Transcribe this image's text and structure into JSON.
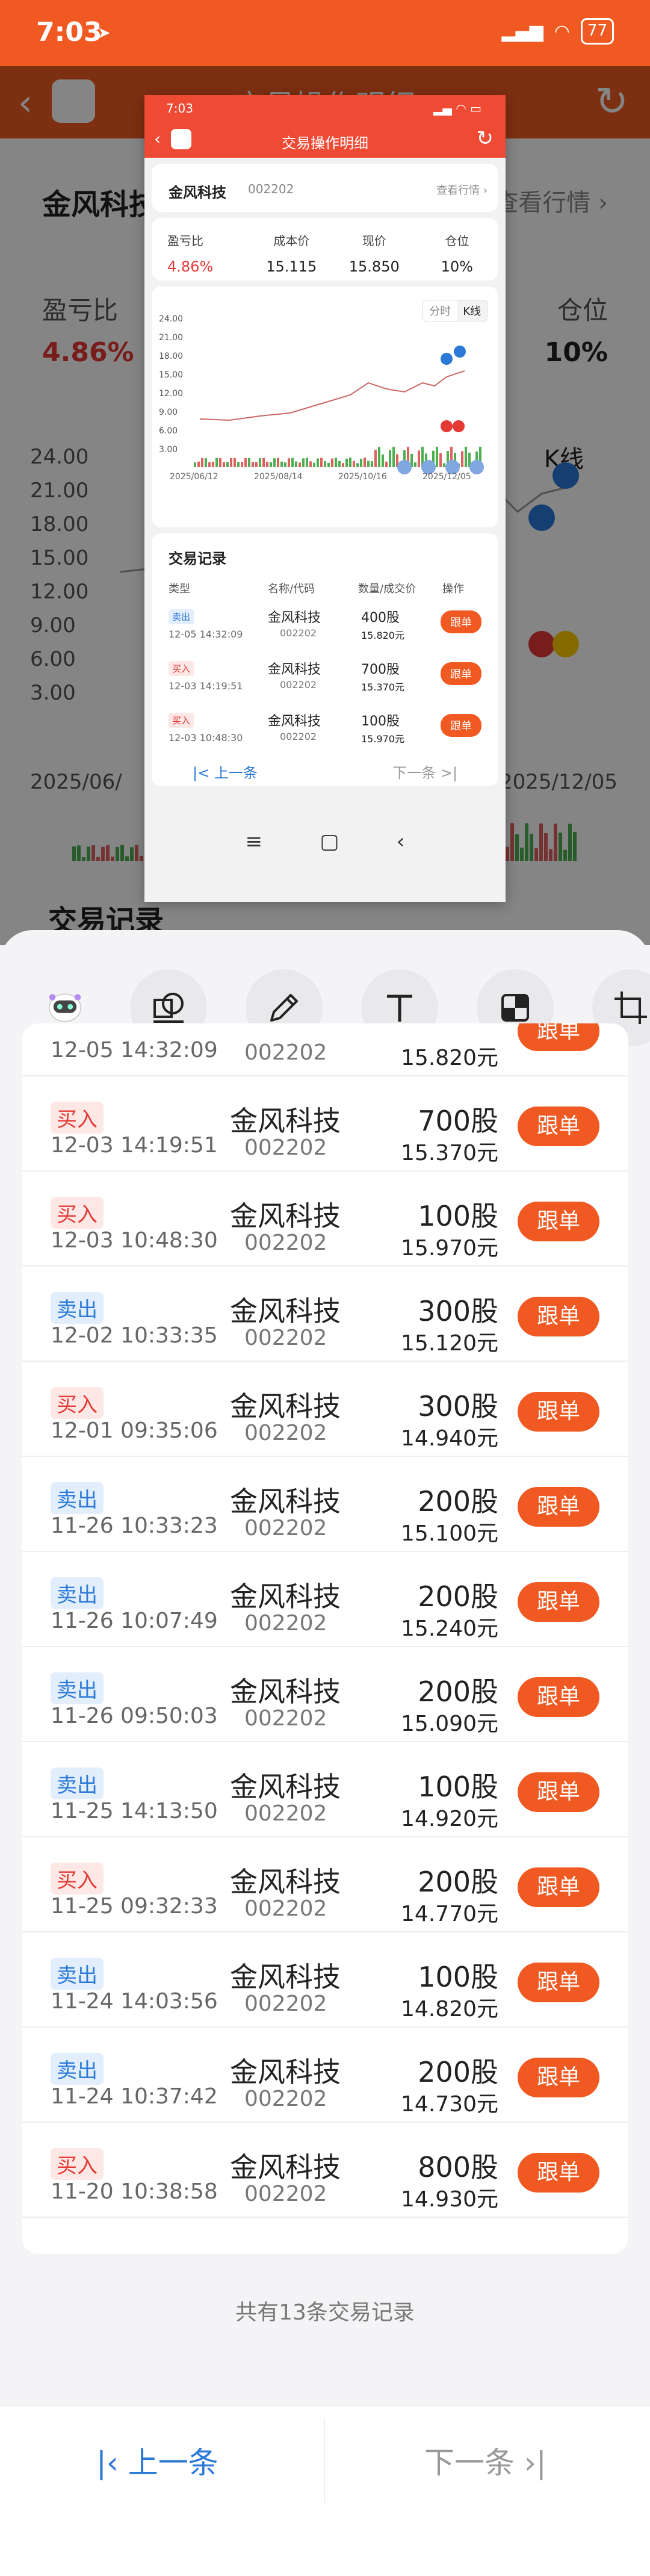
{
  "status_bar": {
    "time": "7:03",
    "battery": "77"
  },
  "background_app": {
    "title": "交易操作明细",
    "stock_name": "金风科技",
    "view_market": "查看行情 ›",
    "profit_label": "盈亏比",
    "profit_value": "4.86%",
    "position_label": "仓位",
    "position_value": "10%",
    "kline_label": "K线",
    "records_title": "交易记录",
    "y_ticks": [
      "24.00",
      "21.00",
      "18.00",
      "15.00",
      "12.00",
      "9.00",
      "6.00",
      "3.00"
    ],
    "x_tick_left": "2025/06/",
    "x_tick_right": "2025/12/05"
  },
  "preview": {
    "time": "7:03",
    "title": "交易操作明细",
    "stock_name": "金风科技",
    "stock_code": "002202",
    "view_market": "查看行情 ›",
    "stats": [
      {
        "label": "盈亏比",
        "value": "4.86%",
        "color": "#e53935"
      },
      {
        "label": "成本价",
        "value": "15.115"
      },
      {
        "label": "现价",
        "value": "15.850"
      },
      {
        "label": "仓位",
        "value": "10%"
      }
    ],
    "tabs": [
      "分时",
      "K线"
    ],
    "y_ticks": [
      "24.00",
      "21.00",
      "18.00",
      "15.00",
      "12.00",
      "9.00",
      "6.00",
      "3.00"
    ],
    "x_ticks": [
      "2025/06/12",
      "2025/08/14",
      "2025/10/16",
      "2025/12/05"
    ],
    "records_title": "交易记录",
    "columns": [
      "类型",
      "名称/代码",
      "数量/成交价",
      "操作"
    ],
    "rows": [
      {
        "type": "卖出",
        "kind": "sell",
        "time": "12-05 14:32:09",
        "name": "金风科技",
        "code": "002202",
        "qty": "400股",
        "price": "15.820元",
        "action": "跟单"
      },
      {
        "type": "买入",
        "kind": "buy",
        "time": "12-03 14:19:51",
        "name": "金风科技",
        "code": "002202",
        "qty": "700股",
        "price": "15.370元",
        "action": "跟单"
      },
      {
        "type": "买入",
        "kind": "buy",
        "time": "12-03 10:48:30",
        "name": "金风科技",
        "code": "002202",
        "qty": "100股",
        "price": "15.970元",
        "action": "跟单"
      }
    ],
    "prev": "|< 上一条",
    "next": "下一条 >|"
  },
  "records": {
    "partial_top": {
      "time": "12-05 14:32:09",
      "code": "002202",
      "price": "15.820元",
      "action": "跟单"
    },
    "rows": [
      {
        "type": "买入",
        "kind": "buy",
        "time": "12-03 14:19:51",
        "name": "金风科技",
        "code": "002202",
        "qty": "700股",
        "price": "15.370元",
        "action": "跟单"
      },
      {
        "type": "买入",
        "kind": "buy",
        "time": "12-03 10:48:30",
        "name": "金风科技",
        "code": "002202",
        "qty": "100股",
        "price": "15.970元",
        "action": "跟单"
      },
      {
        "type": "卖出",
        "kind": "sell",
        "time": "12-02 10:33:35",
        "name": "金风科技",
        "code": "002202",
        "qty": "300股",
        "price": "15.120元",
        "action": "跟单"
      },
      {
        "type": "买入",
        "kind": "buy",
        "time": "12-01 09:35:06",
        "name": "金风科技",
        "code": "002202",
        "qty": "300股",
        "price": "14.940元",
        "action": "跟单"
      },
      {
        "type": "卖出",
        "kind": "sell",
        "time": "11-26 10:33:23",
        "name": "金风科技",
        "code": "002202",
        "qty": "200股",
        "price": "15.100元",
        "action": "跟单"
      },
      {
        "type": "卖出",
        "kind": "sell",
        "time": "11-26 10:07:49",
        "name": "金风科技",
        "code": "002202",
        "qty": "200股",
        "price": "15.240元",
        "action": "跟单"
      },
      {
        "type": "卖出",
        "kind": "sell",
        "time": "11-26 09:50:03",
        "name": "金风科技",
        "code": "002202",
        "qty": "200股",
        "price": "15.090元",
        "action": "跟单"
      },
      {
        "type": "卖出",
        "kind": "sell",
        "time": "11-25 14:13:50",
        "name": "金风科技",
        "code": "002202",
        "qty": "100股",
        "price": "14.920元",
        "action": "跟单"
      },
      {
        "type": "买入",
        "kind": "buy",
        "time": "11-25 09:32:33",
        "name": "金风科技",
        "code": "002202",
        "qty": "200股",
        "price": "14.770元",
        "action": "跟单"
      },
      {
        "type": "卖出",
        "kind": "sell",
        "time": "11-24 14:03:56",
        "name": "金风科技",
        "code": "002202",
        "qty": "100股",
        "price": "14.820元",
        "action": "跟单"
      },
      {
        "type": "卖出",
        "kind": "sell",
        "time": "11-24 10:37:42",
        "name": "金风科技",
        "code": "002202",
        "qty": "200股",
        "price": "14.730元",
        "action": "跟单"
      },
      {
        "type": "买入",
        "kind": "buy",
        "time": "11-20 10:38:58",
        "name": "金风科技",
        "code": "002202",
        "qty": "800股",
        "price": "14.930元",
        "action": "跟单"
      }
    ],
    "total_text": "共有13条交易记录"
  },
  "footer": {
    "prev": "上一条",
    "next": "下一条"
  },
  "colors": {
    "brand_orange": "#f05a22",
    "buy_red": "#e53935",
    "sell_blue": "#2b7ad8"
  },
  "icons": [
    "ai-assistant-icon",
    "shape-icon",
    "pen-icon",
    "text-icon",
    "mosaic-icon",
    "crop-icon",
    "refresh-icon",
    "back-icon"
  ]
}
